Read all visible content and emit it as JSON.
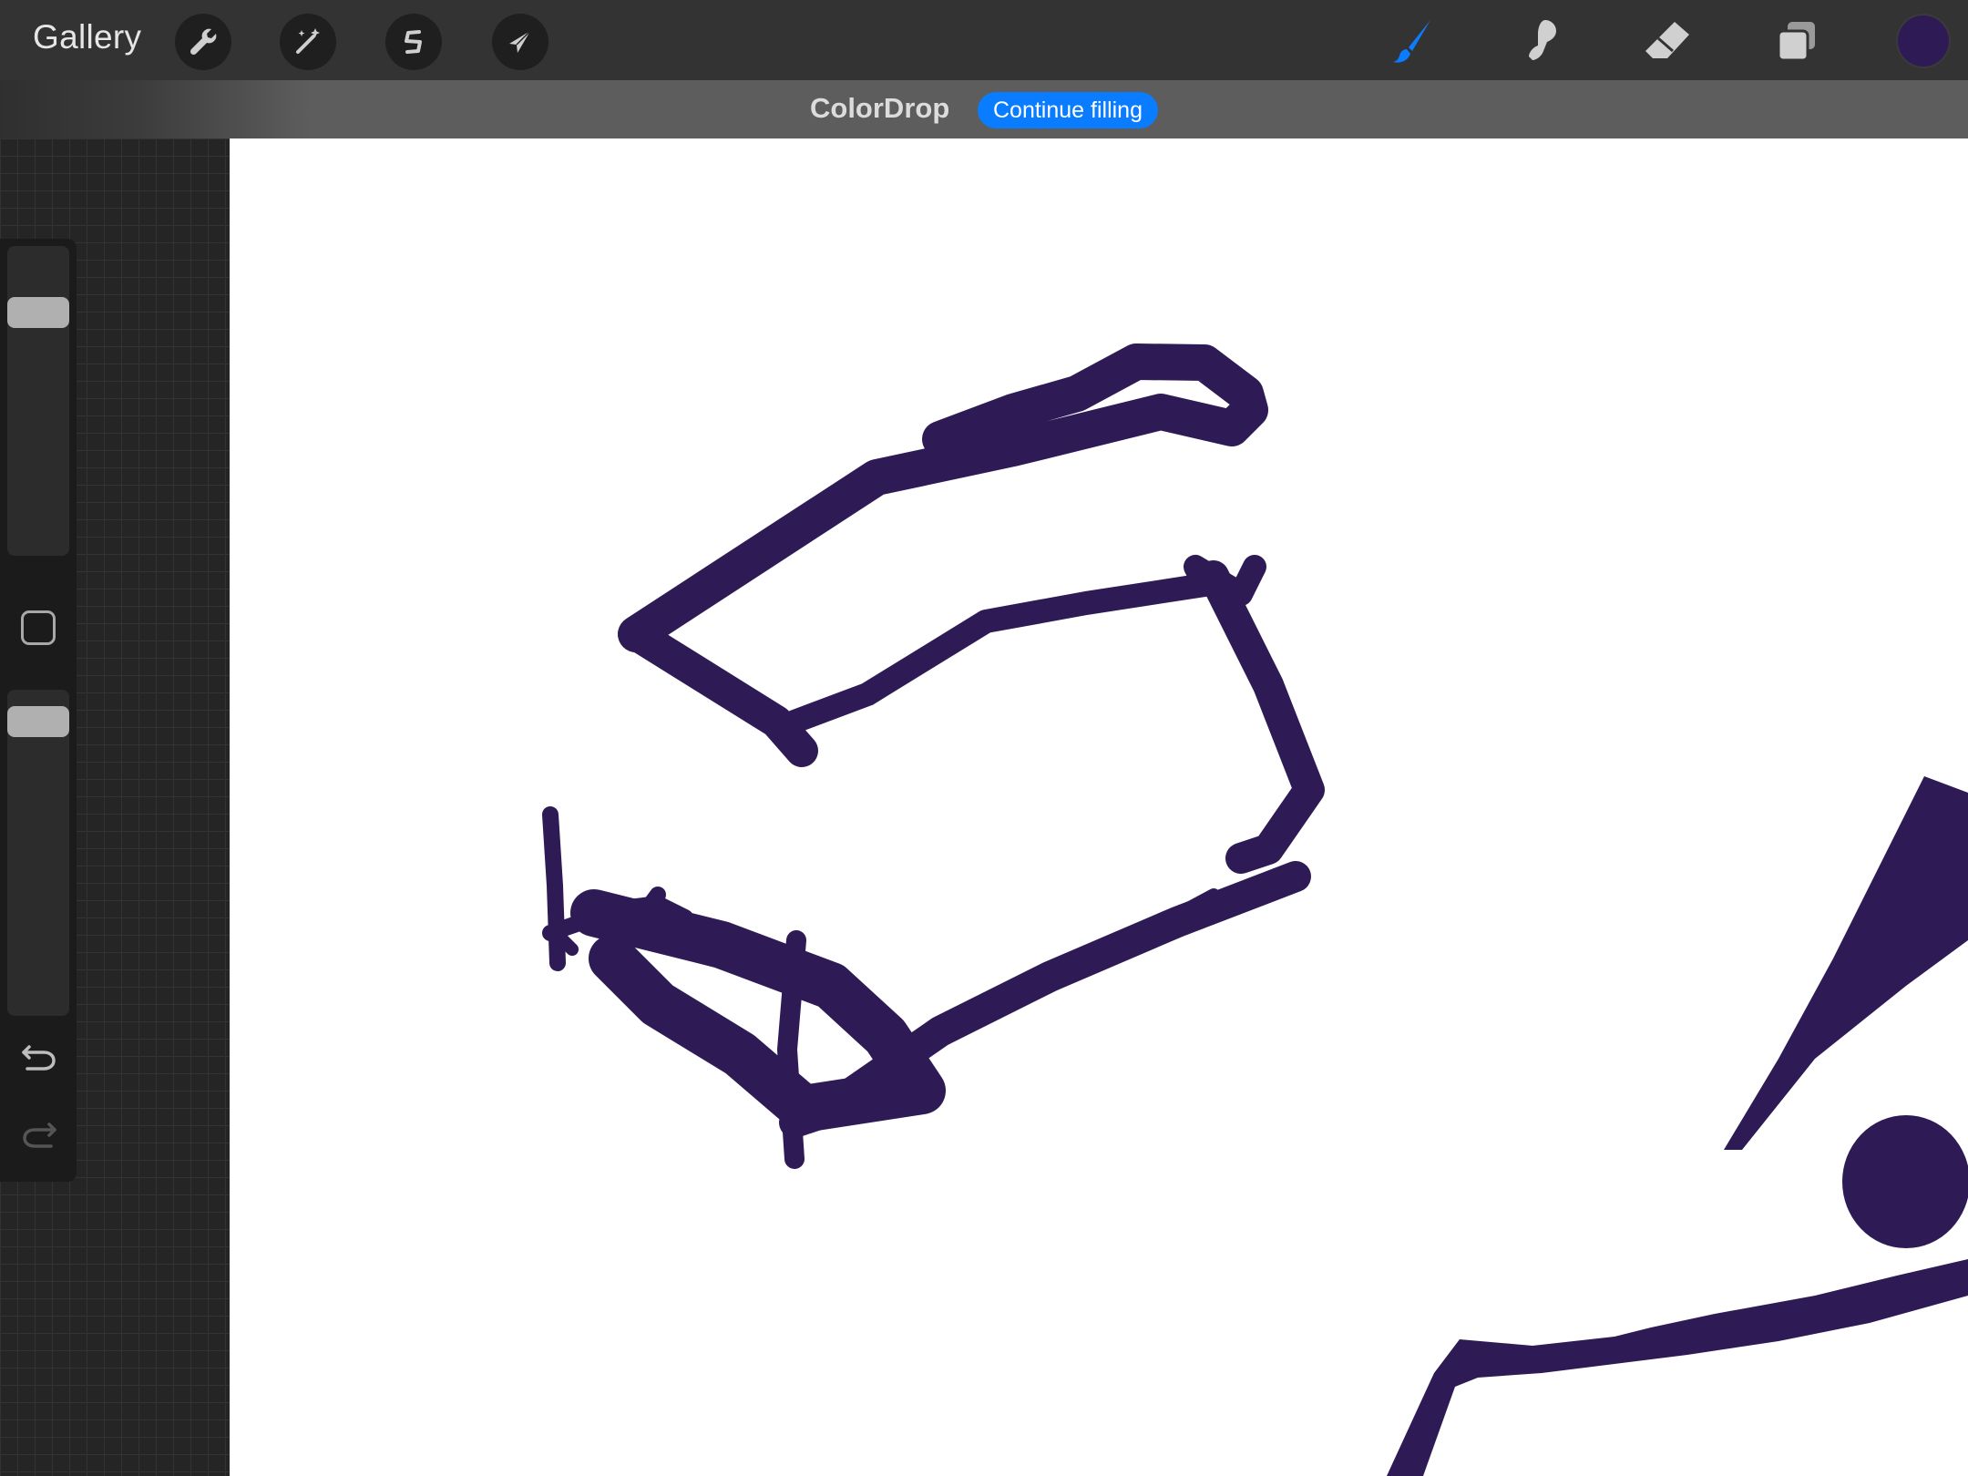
{
  "topbar": {
    "gallery_label": "Gallery",
    "left_tools": [
      {
        "icon": "wrench-icon",
        "name": "actions"
      },
      {
        "icon": "magic-wand-icon",
        "name": "adjustments"
      },
      {
        "icon": "selection-s-icon",
        "name": "selection"
      },
      {
        "icon": "arrow-cursor-icon",
        "name": "transform"
      }
    ],
    "right_tools": [
      {
        "icon": "brush-icon",
        "name": "paint",
        "active": true
      },
      {
        "icon": "smudge-icon",
        "name": "smudge",
        "active": false
      },
      {
        "icon": "eraser-icon",
        "name": "eraser",
        "active": false
      },
      {
        "icon": "layers-icon",
        "name": "layers",
        "active": false
      }
    ],
    "current_color": "#2e1a55"
  },
  "banner": {
    "title": "ColorDrop",
    "button_label": "Continue filling"
  },
  "sidebar": {
    "brush_size_level": 0.82,
    "opacity_level": 0.92,
    "undo_icon": "undo-icon",
    "redo_icon": "redo-icon"
  },
  "colors": {
    "accent": "#0a7cff",
    "stroke": "#2e1a55",
    "canvas": "#ffffff",
    "toolbar": "#333333"
  }
}
